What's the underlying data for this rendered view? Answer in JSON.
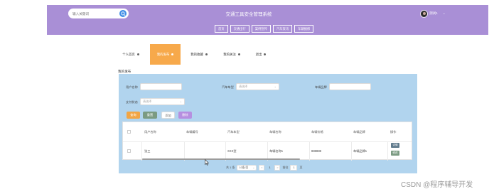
{
  "header": {
    "title": "交通工具安全管理系统",
    "search_placeholder": "输入关键词",
    "user_name": "测试1"
  },
  "nav": [
    "首页",
    "交通出行",
    "案例宣传",
    "汽车资讯",
    "车辆报修"
  ],
  "tabs": [
    "个人首页",
    "我的发布",
    "我的收藏",
    "我的关注",
    "退出"
  ],
  "active_tab_index": 1,
  "section_title": "我的发布",
  "filters": {
    "user_name_label": "用户名称",
    "user_name_value": "",
    "car_type_label": "汽车车型",
    "car_type_placeholder": "请选择",
    "car_brand_label": "车辆品牌",
    "car_brand_value": "",
    "pay_status_label": "支付状态",
    "pay_status_placeholder": "请选择"
  },
  "buttons": {
    "search": "查询",
    "reset": "重置",
    "add": "添加",
    "delete": "删除"
  },
  "table": {
    "columns": [
      "用户名称",
      "车辆编号",
      "汽车车型",
      "车辆名称",
      "车辆价格",
      "车辆品牌",
      "操作"
    ],
    "rows": [
      {
        "user_name": "张三",
        "car_no": "",
        "car_type": "XXX型",
        "car_name": "车辆名称1",
        "price": "888888",
        "brand": "车辆品牌1",
        "detail": "详情",
        "edit": "修改"
      }
    ]
  },
  "pagination": {
    "total_label": "共 1 条",
    "page_size": "10条/页",
    "prev": "<",
    "current_page": "1",
    "next": ">",
    "goto_label": "前往",
    "goto_value": "1",
    "page_suffix": "页"
  },
  "watermark": "CSDN @程序辅导开发",
  "colors": {
    "header_bg": "#a98fd6",
    "active_tab": "#f7a94b",
    "panel_bg": "#b1d4ee",
    "search_btn": "#3f8ee6",
    "btn_search": "#f2a544",
    "btn_reset": "#7b9b82",
    "btn_delete": "#b68fe0"
  }
}
